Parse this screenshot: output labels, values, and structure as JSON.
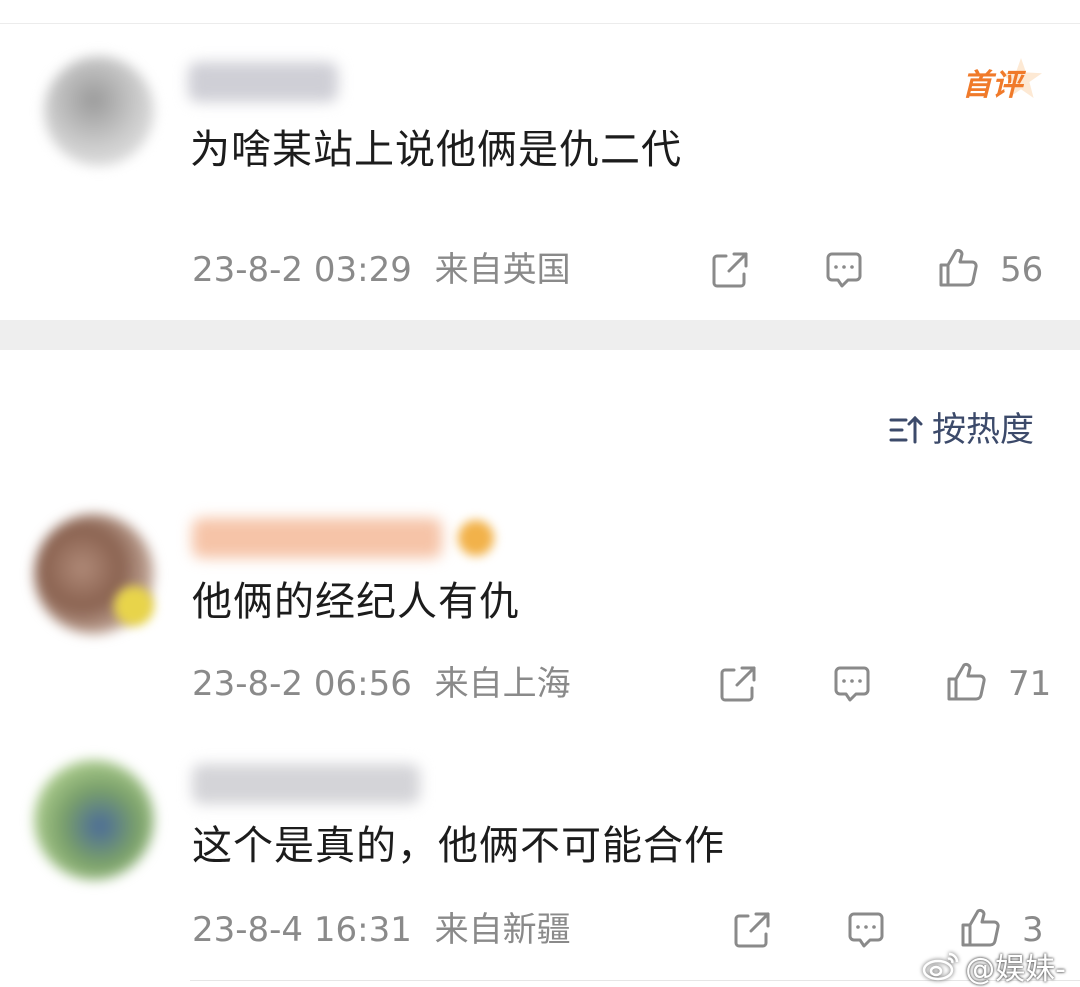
{
  "comments": [
    {
      "text": "为啥某站上说他俩是仇二代",
      "time": "23-8-2 03:29",
      "location": "来自英国",
      "likes": "56",
      "badge": "首评"
    },
    {
      "text": "他俩的经纪人有仇",
      "time": "23-8-2 06:56",
      "location": "来自上海",
      "likes": "71"
    },
    {
      "text": "这个是真的，他俩不可能合作",
      "time": "23-8-4 16:31",
      "location": "来自新疆",
      "likes": "3"
    }
  ],
  "sort": {
    "label": "按热度",
    "icon": "sort-icon"
  },
  "watermark": {
    "text": "@娱妹-",
    "icon": "weibo-icon"
  },
  "icons": {
    "share": "share-icon",
    "comment": "comment-icon",
    "like": "thumbs-up-icon"
  },
  "colors": {
    "badge": "#f07a2a",
    "meta": "#8a8a8a",
    "sort": "#3c4a6a",
    "separator": "#eeeeee"
  }
}
